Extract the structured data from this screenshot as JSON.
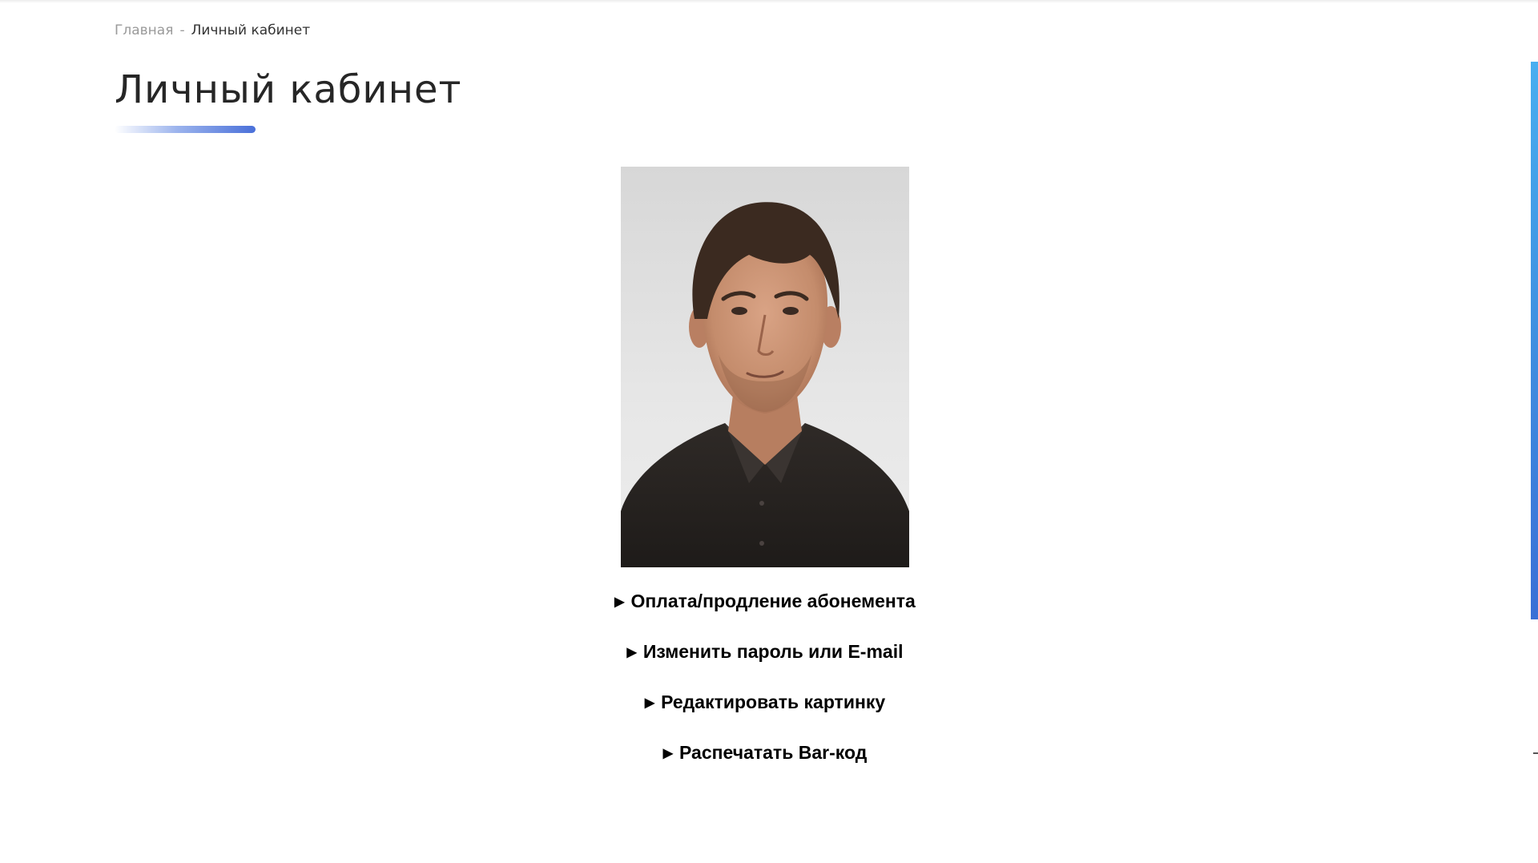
{
  "breadcrumb": {
    "home": "Главная",
    "separator": "-",
    "current": "Личный кабинет"
  },
  "page": {
    "title": "Личный кабинет"
  },
  "menu": {
    "items": [
      {
        "icon": "triangle-right-icon",
        "label": "Оплата/продление абонемента"
      },
      {
        "icon": "triangle-right-icon",
        "label": "Изменить пароль или E-mail"
      },
      {
        "icon": "triangle-right-icon",
        "label": "Редактировать картинку"
      },
      {
        "icon": "triangle-right-icon",
        "label": "Распечатать Bar-код"
      }
    ]
  },
  "colors": {
    "accent": "#4a70d9",
    "scrollbar": "#3f8fe0",
    "title": "#262626",
    "breadcrumb_link": "#9a9a9a"
  }
}
